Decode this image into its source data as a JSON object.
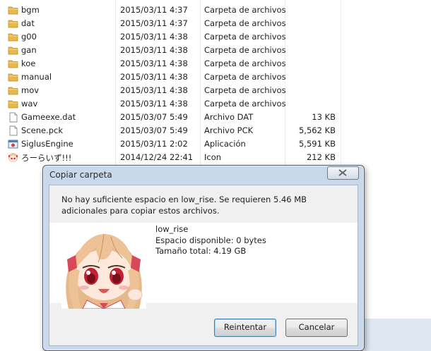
{
  "files": [
    {
      "icon": "folder-icon",
      "name": "bgm",
      "date": "2015/03/11 4:37",
      "type": "Carpeta de archivos",
      "size": ""
    },
    {
      "icon": "folder-icon",
      "name": "dat",
      "date": "2015/03/11 4:37",
      "type": "Carpeta de archivos",
      "size": ""
    },
    {
      "icon": "folder-icon",
      "name": "g00",
      "date": "2015/03/11 4:38",
      "type": "Carpeta de archivos",
      "size": ""
    },
    {
      "icon": "folder-icon",
      "name": "gan",
      "date": "2015/03/11 4:38",
      "type": "Carpeta de archivos",
      "size": ""
    },
    {
      "icon": "folder-icon",
      "name": "koe",
      "date": "2015/03/11 4:38",
      "type": "Carpeta de archivos",
      "size": ""
    },
    {
      "icon": "folder-icon",
      "name": "manual",
      "date": "2015/03/11 4:38",
      "type": "Carpeta de archivos",
      "size": ""
    },
    {
      "icon": "folder-icon",
      "name": "mov",
      "date": "2015/03/11 4:38",
      "type": "Carpeta de archivos",
      "size": ""
    },
    {
      "icon": "folder-icon",
      "name": "wav",
      "date": "2015/03/11 4:38",
      "type": "Carpeta de archivos",
      "size": ""
    },
    {
      "icon": "file-icon",
      "name": "Gameexe.dat",
      "date": "2015/03/07 5:49",
      "type": "Archivo DAT",
      "size": "13 KB"
    },
    {
      "icon": "file-icon",
      "name": "Scene.pck",
      "date": "2015/03/07 5:49",
      "type": "Archivo PCK",
      "size": "5,562 KB"
    },
    {
      "icon": "app-icon",
      "name": "SiglusEngine",
      "date": "2015/03/11 2:02",
      "type": "Aplicación",
      "size": "5,591 KB"
    },
    {
      "icon": "character-icon",
      "name": "ろーらいず!!!",
      "date": "2014/12/24 22:41",
      "type": "Icon",
      "size": "212 KB"
    }
  ],
  "dialog": {
    "title": "Copiar carpeta",
    "message": "No hay suficiente espacio en low_rise. Se requieren 5.46 MB adicionales para copiar estos archivos.",
    "drive_name": "low_rise",
    "free_space": "Espacio disponible: 0 bytes",
    "total_size": "Tamaño total: 4.19 GB",
    "retry_label": "Reintentar",
    "cancel_label": "Cancelar",
    "close_icon": "close-icon",
    "avatar_icon": "anime-girl-avatar"
  },
  "colors": {
    "folder": "#e8b84a",
    "dialog_frame": "#c9d8ea",
    "default_button_border": "#3c7fb1"
  }
}
